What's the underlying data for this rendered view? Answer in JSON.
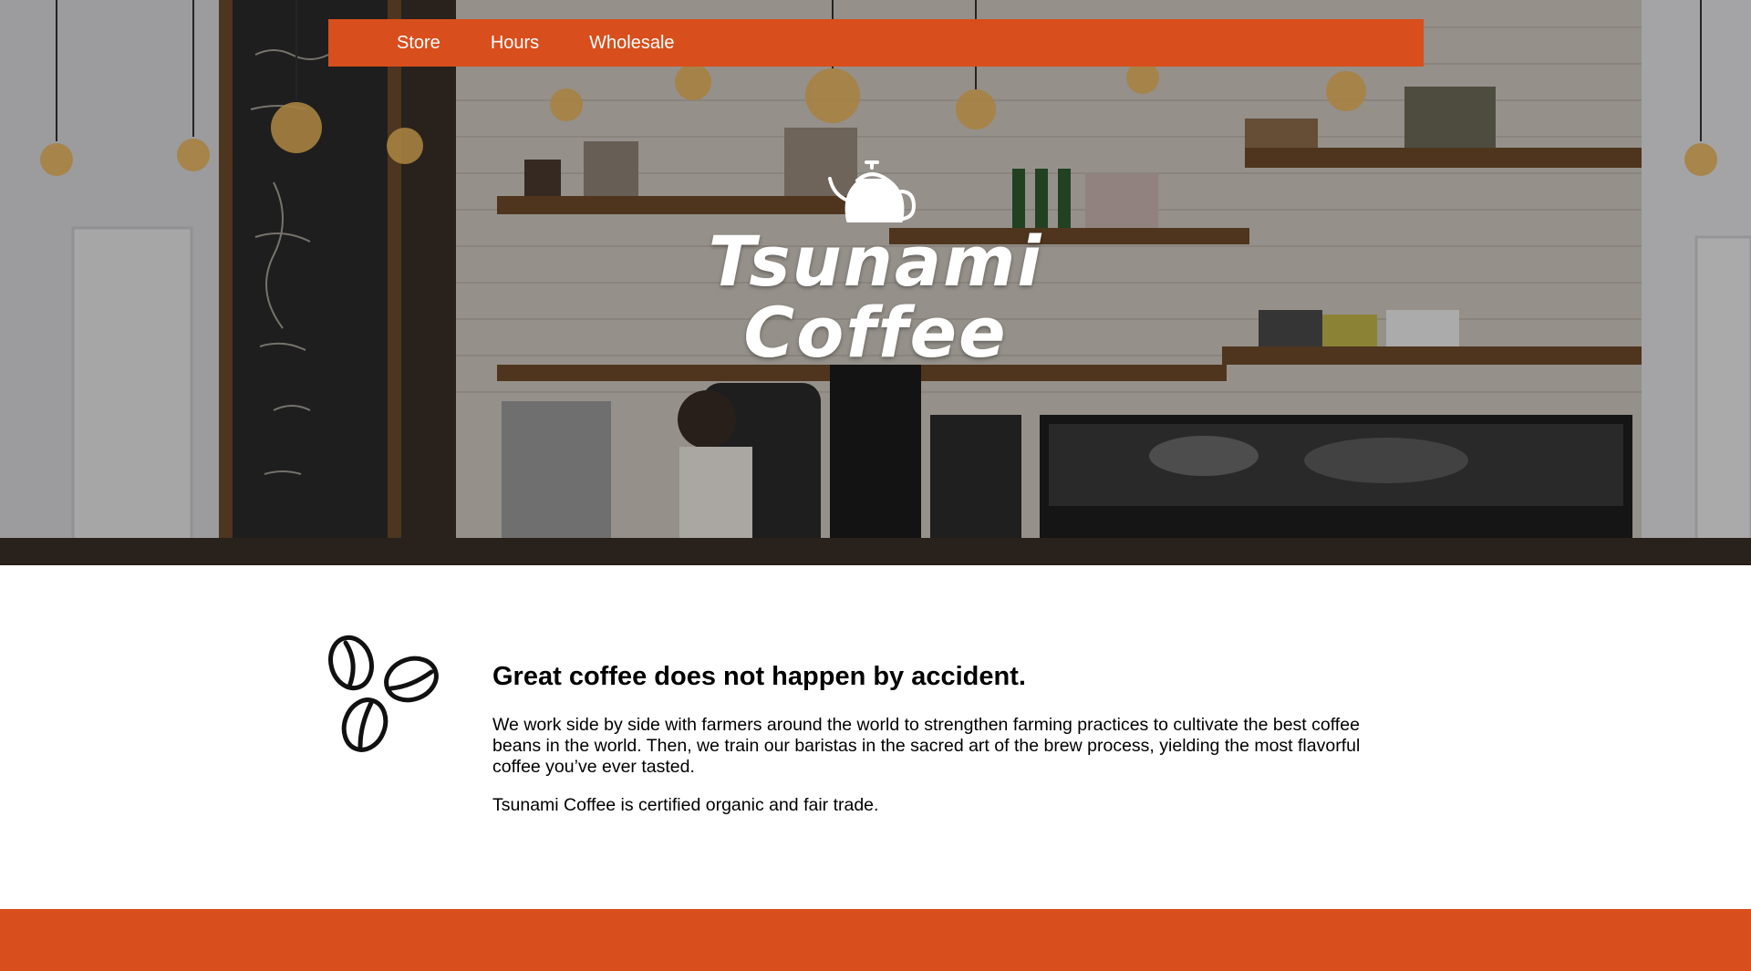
{
  "nav": {
    "items": [
      {
        "label": "Store"
      },
      {
        "label": "Hours"
      },
      {
        "label": "Wholesale"
      }
    ]
  },
  "hero": {
    "brand_line1": "Tsunami",
    "brand_line2": "Coffee",
    "logo_icon": "kettle-icon"
  },
  "main": {
    "icon": "coffee-beans-icon",
    "headline": "Great coffee does not happen by accident.",
    "paragraph1": "We work side by side with farmers around the world to strengthen farming practices to cultivate the best coffee beans in the world. Then, we train our baristas in the sacred art of the brew process, yielding the most flavorful coffee you’ve ever tasted.",
    "paragraph2": "Tsunami Coffee is certified organic and fair trade."
  },
  "colors": {
    "accent": "#d84e1c",
    "text": "#000000",
    "background": "#ffffff"
  }
}
